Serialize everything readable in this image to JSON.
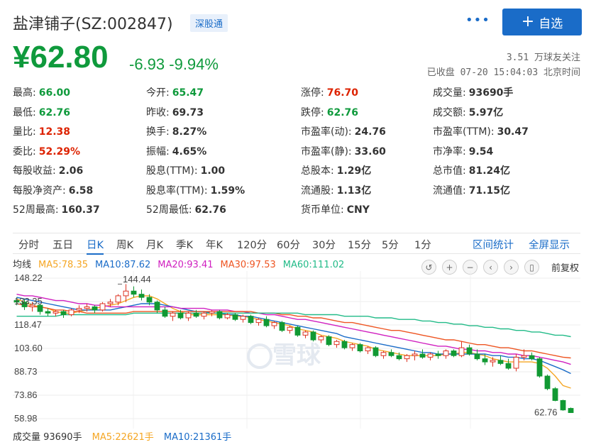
{
  "header": {
    "stock_name": "盐津铺子(SZ:002847)",
    "market_tag": "深股通",
    "more_icon": "more-dots-icon",
    "follow_label": "自选"
  },
  "quote": {
    "price": "¥62.80",
    "change": "-6.93 -9.94%",
    "followers": "3.51 万球友关注",
    "status": "已收盘 07-20 15:04:03 北京时间"
  },
  "stats": [
    {
      "k": "最高:",
      "v": "66.00",
      "c": "green"
    },
    {
      "k": "今开:",
      "v": "65.47",
      "c": "green"
    },
    {
      "k": "涨停:",
      "v": "76.70",
      "c": "red"
    },
    {
      "k": "成交量:",
      "v": "93690手",
      "c": ""
    },
    {
      "k": "最低:",
      "v": "62.76",
      "c": "green"
    },
    {
      "k": "昨收:",
      "v": "69.73",
      "c": ""
    },
    {
      "k": "跌停:",
      "v": "62.76",
      "c": "green"
    },
    {
      "k": "成交额:",
      "v": "5.97亿",
      "c": ""
    },
    {
      "k": "量比:",
      "v": "12.38",
      "c": "red"
    },
    {
      "k": "换手:",
      "v": "8.27%",
      "c": ""
    },
    {
      "k": "市盈率(动):",
      "v": "24.76",
      "c": ""
    },
    {
      "k": "市盈率(TTM):",
      "v": "30.47",
      "c": ""
    },
    {
      "k": "委比:",
      "v": "52.29%",
      "c": "red"
    },
    {
      "k": "振幅:",
      "v": "4.65%",
      "c": ""
    },
    {
      "k": "市盈率(静):",
      "v": "33.60",
      "c": ""
    },
    {
      "k": "市净率:",
      "v": "9.54",
      "c": ""
    },
    {
      "k": "每股收益:",
      "v": "2.06",
      "c": ""
    },
    {
      "k": "股息(TTM):",
      "v": "1.00",
      "c": ""
    },
    {
      "k": "总股本:",
      "v": "1.29亿",
      "c": ""
    },
    {
      "k": "总市值:",
      "v": "81.24亿",
      "c": ""
    },
    {
      "k": "每股净资产:",
      "v": "6.58",
      "c": ""
    },
    {
      "k": "股息率(TTM):",
      "v": "1.59%",
      "c": ""
    },
    {
      "k": "流通股:",
      "v": "1.13亿",
      "c": ""
    },
    {
      "k": "流通值:",
      "v": "71.15亿",
      "c": ""
    },
    {
      "k": "52周最高:",
      "v": "160.37",
      "c": ""
    },
    {
      "k": "52周最低:",
      "v": "62.76",
      "c": ""
    },
    {
      "k": "货币单位:",
      "v": "CNY",
      "c": ""
    }
  ],
  "tabs": [
    "分时",
    "五日",
    "日K",
    "周K",
    "月K",
    "季K",
    "年K",
    "120分",
    "60分",
    "30分",
    "15分",
    "5分",
    "1分"
  ],
  "active_tab": "日K",
  "tab_actions": [
    "区间统计",
    "全屏显示"
  ],
  "ma": {
    "label": "均线",
    "items": [
      {
        "text": "MA5:78.35",
        "color": "#f5a623"
      },
      {
        "text": "MA10:87.62",
        "color": "#1a6cc8"
      },
      {
        "text": "MA20:93.41",
        "color": "#d020c0"
      },
      {
        "text": "MA30:97.53",
        "color": "#ee5522"
      },
      {
        "text": "MA60:111.02",
        "color": "#22bb88"
      }
    ]
  },
  "toolbar_icons": [
    "reset-icon",
    "zoom-in-icon",
    "zoom-out-icon",
    "scroll-left-icon",
    "scroll-right-icon",
    "candle-icon"
  ],
  "adjust_label": "前复权",
  "chart_data": {
    "type": "candlestick",
    "y_ticks": [
      "148.22",
      "133.35",
      "118.47",
      "103.60",
      "88.73",
      "73.86",
      "58.98"
    ],
    "ylim": [
      58.98,
      148.22
    ],
    "high_label": "144.44",
    "low_label": "62.76",
    "watermark": "雪球",
    "candles": [
      [
        134,
        136,
        131,
        133
      ],
      [
        133,
        135,
        128,
        130
      ],
      [
        130,
        133,
        127,
        131
      ],
      [
        131,
        132,
        125,
        127
      ],
      [
        127,
        129,
        124,
        126
      ],
      [
        126,
        128,
        124,
        127
      ],
      [
        127,
        128,
        123,
        125
      ],
      [
        125,
        129,
        124,
        128
      ],
      [
        128,
        131,
        126,
        129
      ],
      [
        129,
        132,
        127,
        130
      ],
      [
        130,
        131,
        126,
        128
      ],
      [
        128,
        133,
        127,
        132
      ],
      [
        132,
        135,
        130,
        133
      ],
      [
        133,
        138,
        131,
        137
      ],
      [
        137,
        144.44,
        133,
        140
      ],
      [
        140,
        143,
        136,
        138
      ],
      [
        138,
        141,
        134,
        136
      ],
      [
        136,
        138,
        131,
        133
      ],
      [
        133,
        134,
        126,
        128
      ],
      [
        128,
        130,
        123,
        124
      ],
      [
        124,
        127,
        121,
        126
      ],
      [
        126,
        128,
        122,
        123
      ],
      [
        123,
        127,
        121,
        126
      ],
      [
        126,
        128,
        123,
        124
      ],
      [
        124,
        127,
        122,
        126
      ],
      [
        126,
        128,
        124,
        127
      ],
      [
        127,
        128,
        122,
        123
      ],
      [
        123,
        126,
        122,
        125
      ],
      [
        125,
        126,
        121,
        122
      ],
      [
        122,
        125,
        120,
        124
      ],
      [
        124,
        125,
        119,
        120
      ],
      [
        120,
        123,
        118,
        122
      ],
      [
        122,
        124,
        117,
        118
      ],
      [
        118,
        121,
        116,
        120
      ],
      [
        120,
        121,
        114,
        115
      ],
      [
        115,
        118,
        113,
        117
      ],
      [
        117,
        118,
        111,
        112
      ],
      [
        112,
        115,
        110,
        114
      ],
      [
        114,
        115,
        108,
        109
      ],
      [
        109,
        112,
        107,
        111
      ],
      [
        111,
        112,
        105,
        106
      ],
      [
        106,
        109,
        104,
        108
      ],
      [
        108,
        109,
        103,
        104
      ],
      [
        104,
        107,
        102,
        106
      ],
      [
        106,
        107,
        101,
        102
      ],
      [
        102,
        105,
        100,
        104
      ],
      [
        104,
        105,
        98,
        99
      ],
      [
        99,
        102,
        97,
        101
      ],
      [
        101,
        103,
        98,
        99
      ],
      [
        99,
        101,
        96,
        97
      ],
      [
        97,
        100,
        95,
        99
      ],
      [
        99,
        102,
        96,
        100
      ],
      [
        100,
        103,
        97,
        98
      ],
      [
        98,
        101,
        96,
        100
      ],
      [
        100,
        102,
        97,
        99
      ],
      [
        99,
        103,
        97,
        102
      ],
      [
        102,
        103,
        98,
        99
      ],
      [
        99,
        108,
        98,
        104
      ],
      [
        104,
        106,
        99,
        100
      ],
      [
        100,
        103,
        96,
        97
      ],
      [
        97,
        100,
        93,
        95
      ],
      [
        95,
        98,
        92,
        96
      ],
      [
        96,
        99,
        93,
        94
      ],
      [
        94,
        97,
        90,
        91
      ],
      [
        91,
        100,
        89,
        98
      ],
      [
        98,
        103,
        96,
        99
      ],
      [
        99,
        101,
        96,
        97
      ],
      [
        97,
        98,
        85,
        86
      ],
      [
        86,
        87,
        77,
        78
      ],
      [
        78,
        79,
        70,
        70.5
      ],
      [
        70.5,
        71,
        64,
        64.5
      ],
      [
        65.47,
        66,
        62.76,
        62.8
      ]
    ],
    "ma": [
      {
        "name": "MA5",
        "color": "#f5a623",
        "values": [
          135,
          133,
          131,
          130,
          129,
          127,
          126,
          126,
          127,
          128,
          129,
          130,
          131,
          132,
          134,
          136,
          137,
          137,
          135,
          132,
          129,
          127,
          125,
          125,
          125,
          125,
          125,
          125,
          124,
          124,
          123,
          122,
          121,
          120,
          119,
          118,
          116,
          115,
          114,
          112,
          111,
          110,
          108,
          107,
          106,
          105,
          103,
          102,
          101,
          100,
          99,
          99,
          99,
          99,
          99,
          100,
          100,
          101,
          101,
          100,
          99,
          97,
          96,
          95,
          95,
          95,
          95,
          94,
          91,
          86,
          80,
          78.35
        ]
      },
      {
        "name": "MA10",
        "color": "#1a6cc8",
        "values": [
          136,
          135,
          134,
          133,
          132,
          131,
          130,
          129,
          128,
          128,
          128,
          128,
          128,
          129,
          130,
          131,
          132,
          132,
          132,
          131,
          130,
          129,
          128,
          127,
          127,
          126,
          126,
          125,
          125,
          124,
          124,
          123,
          122,
          121,
          120,
          119,
          118,
          117,
          116,
          115,
          114,
          113,
          111,
          110,
          109,
          108,
          107,
          106,
          105,
          104,
          103,
          102,
          101,
          101,
          100,
          100,
          100,
          100,
          100,
          100,
          100,
          99,
          99,
          98,
          98,
          97,
          97,
          96,
          94,
          92,
          90,
          87.62
        ]
      },
      {
        "name": "MA20",
        "color": "#d020c0",
        "values": [
          138,
          137,
          137,
          136,
          135,
          134,
          134,
          133,
          132,
          132,
          131,
          131,
          130,
          130,
          130,
          130,
          130,
          130,
          130,
          130,
          130,
          129,
          129,
          129,
          129,
          128,
          128,
          128,
          127,
          127,
          126,
          126,
          125,
          125,
          124,
          123,
          122,
          122,
          121,
          120,
          119,
          118,
          117,
          116,
          115,
          114,
          113,
          112,
          111,
          110,
          109,
          108,
          107,
          106,
          105,
          105,
          104,
          103,
          103,
          102,
          102,
          101,
          101,
          100,
          100,
          99,
          99,
          98,
          97,
          96,
          95,
          93.41
        ]
      },
      {
        "name": "MA30",
        "color": "#ee5522",
        "values": [
          132,
          131,
          130,
          130,
          129,
          128,
          128,
          127,
          127,
          126,
          126,
          126,
          126,
          126,
          126,
          127,
          127,
          127,
          127,
          127,
          127,
          127,
          127,
          127,
          127,
          127,
          127,
          127,
          127,
          127,
          127,
          126,
          126,
          126,
          125,
          125,
          124,
          124,
          123,
          123,
          122,
          121,
          120,
          120,
          119,
          118,
          117,
          116,
          115,
          115,
          114,
          113,
          112,
          111,
          110,
          109,
          109,
          108,
          107,
          106,
          106,
          105,
          104,
          104,
          103,
          102,
          102,
          101,
          100,
          99,
          98,
          97.53
        ]
      },
      {
        "name": "MA60",
        "color": "#22bb88",
        "values": [
          124,
          124,
          124,
          124,
          124,
          124,
          125,
          125,
          125,
          125,
          125,
          125,
          125,
          125,
          125,
          126,
          126,
          126,
          126,
          126,
          126,
          126,
          126,
          126,
          126,
          126,
          126,
          126,
          126,
          126,
          126,
          126,
          126,
          126,
          126,
          126,
          126,
          125,
          125,
          125,
          125,
          125,
          124,
          124,
          124,
          124,
          123,
          123,
          123,
          122,
          122,
          122,
          121,
          121,
          120,
          120,
          119,
          119,
          118,
          118,
          117,
          117,
          116,
          116,
          115,
          115,
          114,
          114,
          113,
          112,
          112,
          111.02
        ]
      }
    ]
  },
  "volume": {
    "label": "成交量 93690手",
    "ma5": "MA5:22621手",
    "ma10": "MA10:21361手",
    "ma5_color": "#f5a623",
    "ma10_color": "#1a6cc8"
  }
}
